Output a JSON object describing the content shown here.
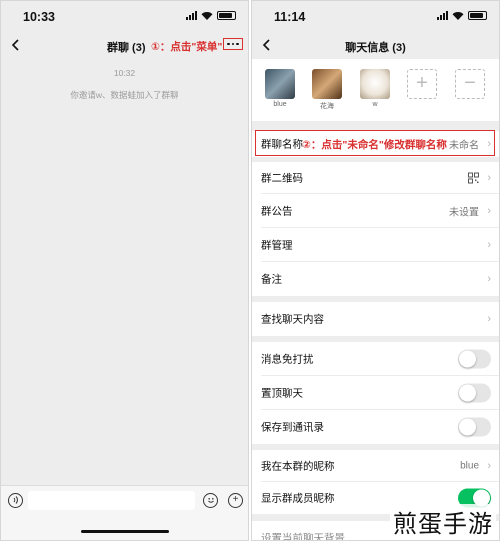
{
  "left": {
    "status_time": "10:33",
    "title": "群聊 (3)",
    "annotation": "①：点击\"菜单\"",
    "time_label": "10:32",
    "system_message": "你邀请w、数据蛙加入了群聊"
  },
  "right": {
    "status_time": "11:14",
    "title": "聊天信息 (3)",
    "members": [
      {
        "name": "blue"
      },
      {
        "name": "花海"
      },
      {
        "name": "w"
      }
    ],
    "add_button_icon": "plus-icon",
    "remove_button_icon": "minus-icon",
    "group_name": {
      "label": "群聊名称",
      "value": "未命名"
    },
    "annotation": "②：点击\"未命名\"修改群聊名称",
    "group_qr": {
      "label": "群二维码"
    },
    "announcement": {
      "label": "群公告",
      "value": "未设置"
    },
    "manage": {
      "label": "群管理"
    },
    "remark": {
      "label": "备注"
    },
    "search_history": {
      "label": "查找聊天内容"
    },
    "mute": {
      "label": "消息免打扰",
      "on": false
    },
    "pin": {
      "label": "置顶聊天",
      "on": false
    },
    "save_contacts": {
      "label": "保存到通讯录",
      "on": false
    },
    "my_nickname": {
      "label": "我在本群的昵称",
      "value": "blue"
    },
    "show_nicknames": {
      "label": "显示群成员昵称",
      "on": true
    },
    "chat_background": {
      "label": "设置当前聊天背景"
    }
  },
  "watermark": "煎蛋手游",
  "colors": {
    "annotation_red": "#d93030",
    "toggle_on": "#07c160"
  }
}
